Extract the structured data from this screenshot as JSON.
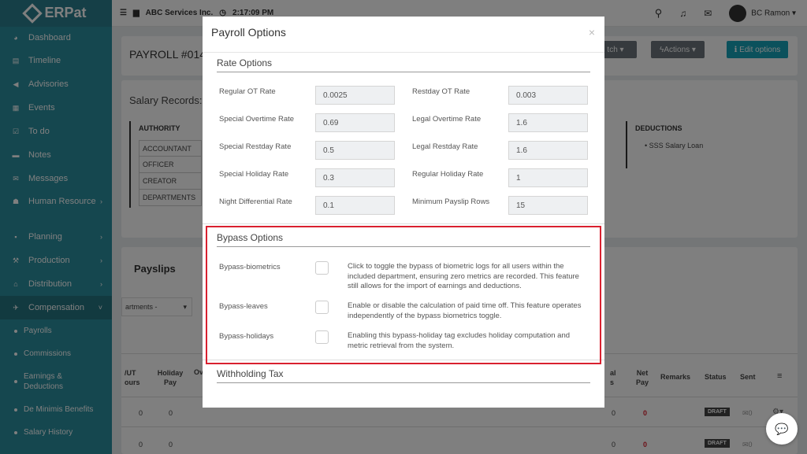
{
  "app": {
    "name": "ERPat"
  },
  "topbar": {
    "company": "ABC Services Inc.",
    "time": "2:17:09 PM",
    "user": "BC Ramon"
  },
  "sidebar": {
    "items": [
      {
        "label": "Dashboard",
        "icon": "dashboard-icon"
      },
      {
        "label": "Timeline",
        "icon": "timeline-icon"
      },
      {
        "label": "Advisories",
        "icon": "megaphone-icon"
      },
      {
        "label": "Events",
        "icon": "calendar-icon"
      },
      {
        "label": "To do",
        "icon": "checkbox-icon"
      },
      {
        "label": "Notes",
        "icon": "note-icon"
      },
      {
        "label": "Messages",
        "icon": "envelope-icon"
      },
      {
        "label": "Human Resource",
        "icon": "users-icon"
      },
      {
        "label": "Planning",
        "icon": "briefcase-icon"
      },
      {
        "label": "Production",
        "icon": "gavel-icon"
      },
      {
        "label": "Distribution",
        "icon": "bank-icon"
      },
      {
        "label": "Compensation",
        "icon": "compensation-icon"
      }
    ],
    "subitems": [
      "Payrolls",
      "Commissions",
      "Earnings & Deductions",
      "De Minimis Benefits",
      "Salary History"
    ]
  },
  "background": {
    "payroll_title": "PAYROLL #014",
    "salary_records": "Salary Records:",
    "authority_header": "AUTHORITY",
    "authority_rows": [
      "ACCOUNTANT",
      "OFFICER",
      "CREATOR",
      "DEPARTMENTS"
    ],
    "deductions_header": "DEDUCTIONS",
    "deductions_item": "SSS Salary Loan",
    "batch_btn": "tch",
    "actions_btn": "Actions",
    "edit_btn": "Edit options",
    "payslips": "Payslips",
    "dept_filter": "artments -",
    "col_ut": "/UT ours",
    "col_holiday": "Holiday Pay",
    "col_over": "Over",
    "col_al": "al s",
    "col_net": "Net Pay",
    "col_remarks": "Remarks",
    "col_status": "Status",
    "col_sent": "Sent",
    "draft": "DRAFT",
    "zero": "0"
  },
  "modal": {
    "title": "Payroll Options",
    "close": "×",
    "rate_title": "Rate Options",
    "rates_left": [
      {
        "label": "Regular OT Rate",
        "value": "0.0025"
      },
      {
        "label": "Special Overtime Rate",
        "value": "0.69"
      },
      {
        "label": "Special Restday Rate",
        "value": "0.5"
      },
      {
        "label": "Special Holiday Rate",
        "value": "0.3"
      },
      {
        "label": "Night Differential Rate",
        "value": "0.1"
      }
    ],
    "rates_right": [
      {
        "label": "Restday OT Rate",
        "value": "0.003"
      },
      {
        "label": "Legal Overtime Rate",
        "value": "1.6"
      },
      {
        "label": "Legal Restday Rate",
        "value": "1.6"
      },
      {
        "label": "Regular Holiday Rate",
        "value": "1"
      },
      {
        "label": "Minimum Payslip Rows",
        "value": "15"
      }
    ],
    "bypass_title": "Bypass Options",
    "bypass": [
      {
        "label": "Bypass-biometrics",
        "desc": "Click to toggle the bypass of biometric logs for all users within the included department, ensuring zero metrics are recorded. This feature still allows for the import of earnings and deductions."
      },
      {
        "label": "Bypass-leaves",
        "desc": "Enable or disable the calculation of paid time off. This feature operates independently of the bypass biometrics toggle."
      },
      {
        "label": "Bypass-holidays",
        "desc": "Enabling this bypass-holiday tag excludes holiday computation and metric retrieval from the system."
      }
    ],
    "withholding_title": "Withholding Tax"
  },
  "colors": {
    "sidebar": "#2a8e9e",
    "highlight": "#d9202f",
    "edit_button": "#17a2b8",
    "actions_button": "#6c757d",
    "draft_badge": "#444"
  }
}
